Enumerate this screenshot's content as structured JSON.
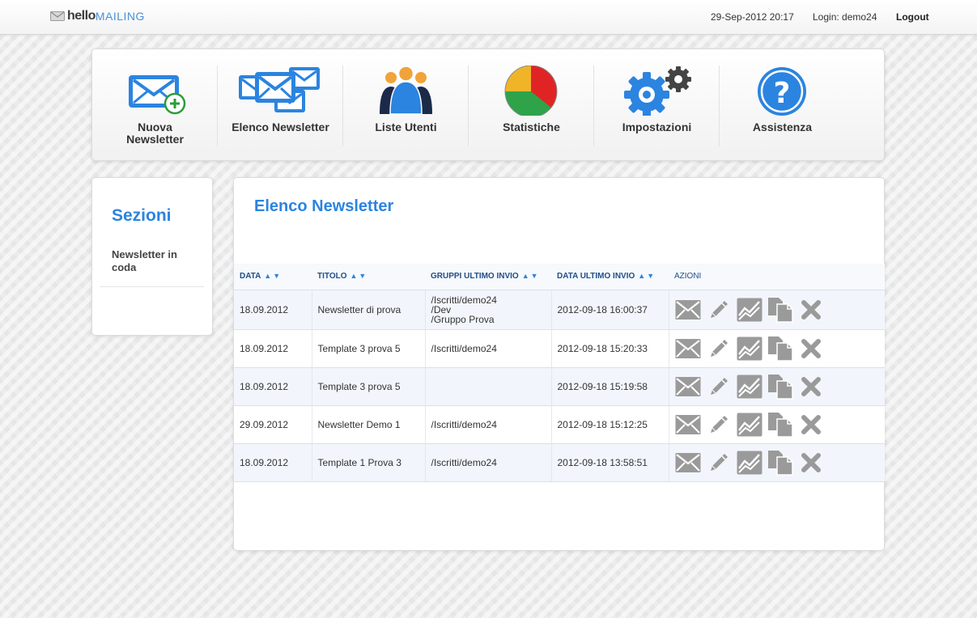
{
  "header": {
    "logo_hello": "hello",
    "logo_mailing": "MAILING",
    "datetime": "29-Sep-2012 20:17",
    "login": "Login: demo24",
    "logout": "Logout"
  },
  "toolbar": {
    "items": [
      {
        "label": "Nuova Newsletter",
        "icon": "new-newsletter-icon"
      },
      {
        "label": "Elenco Newsletter",
        "icon": "newsletter-list-icon"
      },
      {
        "label": "Liste Utenti",
        "icon": "users-icon"
      },
      {
        "label": "Statistiche",
        "icon": "pie-chart-icon"
      },
      {
        "label": "Impostazioni",
        "icon": "gears-icon"
      },
      {
        "label": "Assistenza",
        "icon": "help-icon"
      }
    ]
  },
  "sidebar": {
    "title": "Sezioni",
    "items": [
      {
        "label": "Newsletter in coda"
      }
    ]
  },
  "main": {
    "title": "Elenco Newsletter",
    "columns": [
      "DATA",
      "TITOLO",
      "GRUPPI ULTIMO INVIO",
      "DATA ULTIMO INVIO",
      "AZIONI"
    ],
    "sort_glyph": "▲▼",
    "rows": [
      {
        "data": "18.09.2012",
        "titolo": "Newsletter di prova",
        "gruppi": [
          "/Iscritti/demo24",
          "/Dev",
          "/Gruppo Prova"
        ],
        "data_invio": "2012-09-18 16:00:37"
      },
      {
        "data": "18.09.2012",
        "titolo": "Template 3 prova 5",
        "gruppi": [
          "/Iscritti/demo24"
        ],
        "data_invio": "2012-09-18 15:20:33"
      },
      {
        "data": "18.09.2012",
        "titolo": "Template 3 prova 5",
        "gruppi": [],
        "data_invio": "2012-09-18 15:19:58"
      },
      {
        "data": "29.09.2012",
        "titolo": "Newsletter Demo 1",
        "gruppi": [
          "/Iscritti/demo24"
        ],
        "data_invio": "2012-09-18 15:12:25"
      },
      {
        "data": "18.09.2012",
        "titolo": "Template 1 Prova 3",
        "gruppi": [
          "/Iscritti/demo24"
        ],
        "data_invio": "2012-09-18 13:58:51"
      }
    ],
    "row_actions": [
      "send-icon",
      "edit-icon",
      "stats-icon",
      "copy-icon",
      "delete-icon"
    ]
  },
  "colors": {
    "accent": "#2b84e0",
    "header_text": "#1e4f8a",
    "row_alt": "#f2f6fc",
    "action_icon": "#9a9a9a"
  }
}
